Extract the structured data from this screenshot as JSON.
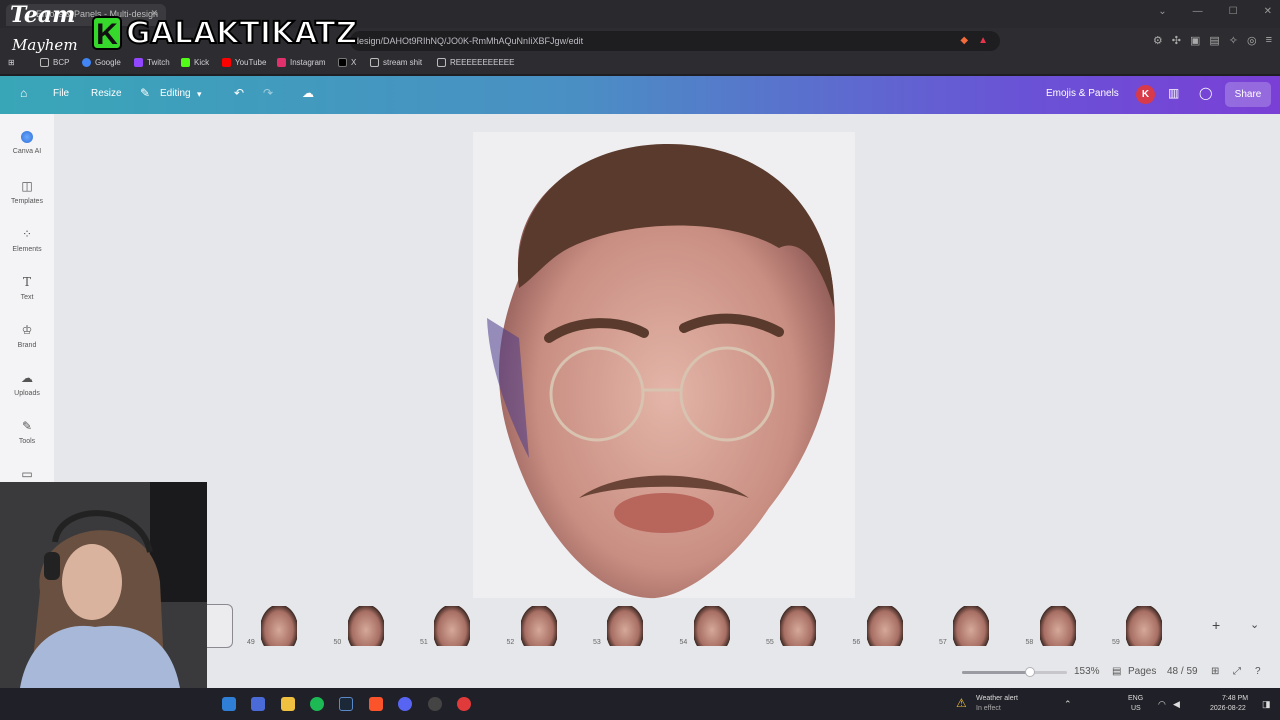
{
  "browser": {
    "tab_title": "Emojis & Panels - Multi-design",
    "url": "design/DAHOt9RIhNQ/JO0K-RmMhAQuNnIiXBFJgw/edit"
  },
  "bookmarks": [
    {
      "label": "BCP",
      "icon": "folder-icon",
      "color": "#888888"
    },
    {
      "label": "Google",
      "icon": "google-icon",
      "color": "#4285f4"
    },
    {
      "label": "Twitch",
      "icon": "twitch-icon",
      "color": "#9146ff"
    },
    {
      "label": "Kick",
      "icon": "kick-icon",
      "color": "#53fc18"
    },
    {
      "label": "YouTube",
      "icon": "youtube-icon",
      "color": "#ff0000"
    },
    {
      "label": "Instagram",
      "icon": "instagram-icon",
      "color": "#e1306c"
    },
    {
      "label": "X",
      "icon": "x-icon",
      "color": "#000000"
    },
    {
      "label": "stream shit",
      "icon": "folder-icon",
      "color": "#888888"
    },
    {
      "label": "REEEEEEEEEEE",
      "icon": "folder-icon",
      "color": "#888888"
    }
  ],
  "header": {
    "file": "File",
    "resize": "Resize",
    "editing": "Editing",
    "doc_title": "Emojis & Panels",
    "avatar": "K",
    "share": "Share"
  },
  "sidebar": [
    {
      "label": "Canva AI",
      "icon": "canva-ai-icon"
    },
    {
      "label": "Templates",
      "icon": "templates-icon"
    },
    {
      "label": "Elements",
      "icon": "elements-icon"
    },
    {
      "label": "Text",
      "icon": "text-icon"
    },
    {
      "label": "Brand",
      "icon": "brand-icon"
    },
    {
      "label": "Uploads",
      "icon": "uploads-icon"
    },
    {
      "label": "Tools",
      "icon": "tools-icon"
    },
    {
      "label": "",
      "icon": "folder-icon"
    }
  ],
  "thumbnails": [
    "49",
    "50",
    "51",
    "52",
    "53",
    "54",
    "55",
    "56",
    "57",
    "58",
    "59"
  ],
  "footer": {
    "zoom": "153%",
    "zoom_level": 0.65,
    "pages_label": "Pages",
    "page_count": "48 / 59"
  },
  "taskbar": {
    "weather_title": "Weather alert",
    "weather_sub": "In effect",
    "lang": "ENG",
    "region": "US",
    "time": "7:48 PM",
    "date": "2026-08-22"
  },
  "overlay": {
    "team": "Team",
    "mayhem": "Mayhem",
    "k": "K",
    "name": "GALAKTIKATZ"
  },
  "colors": {
    "header_start": "#39a6b8",
    "header_end": "#7a3fd6",
    "avatar": "#d83a4a",
    "kick_green": "#36d82b"
  }
}
